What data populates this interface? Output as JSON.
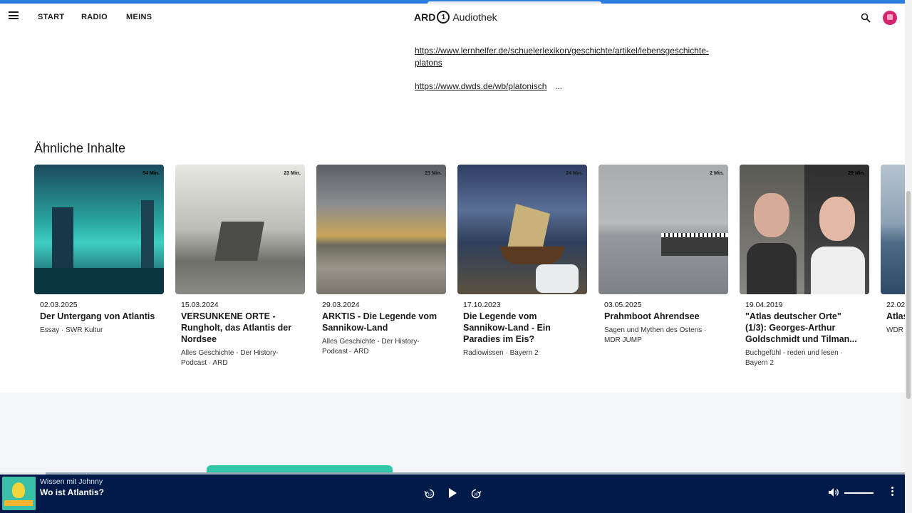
{
  "nav": {
    "items": [
      "START",
      "RADIO",
      "MEINS"
    ],
    "logo_ard": "ARD",
    "logo_one": "1",
    "logo_text": "Audiothek"
  },
  "links": {
    "link1": "https://www.lernhelfer.de/schuelerlexikon/geschichte/artikel/lebensgeschichte-platons",
    "link2": "https://www.dwds.de/wb/platonisch",
    "ellipsis": "..."
  },
  "similar": {
    "heading": "Ähnliche Inhalte",
    "cards": [
      {
        "duration": "54 Min.",
        "date": "02.03.2025",
        "title": "Der Untergang von Atlantis",
        "meta": "Essay · SWR Kultur"
      },
      {
        "duration": "23 Min.",
        "date": "15.03.2024",
        "title": "VERSUNKENE ORTE - Rungholt, das Atlantis der Nordsee",
        "meta": "Alles Geschichte - Der History-Podcast · ARD"
      },
      {
        "duration": "23 Min.",
        "date": "29.03.2024",
        "title": "ARKTIS - Die Legende vom Sannikow-Land",
        "meta": "Alles Geschichte - Der History-Podcast · ARD"
      },
      {
        "duration": "24 Min.",
        "date": "17.10.2023",
        "title": "Die Legende vom Sannikow-Land - Ein Paradies im Eis?",
        "meta": "Radiowissen · Bayern 2"
      },
      {
        "duration": "2 Min.",
        "date": "03.05.2025",
        "title": "Prahmboot Ahrendsee",
        "meta": "Sagen und Mythen des Ostens · MDR JUMP"
      },
      {
        "duration": "29 Min.",
        "date": "19.04.2019",
        "title": "\"Atlas deutscher Orte\" (1/3): Georges-Arthur Goldschmidt und Tilman...",
        "meta": "Buchgefühl - reden und lesen · Bayern 2"
      },
      {
        "duration": "",
        "date": "22.02",
        "title": "Atlas Insel Reise",
        "meta": "WDR"
      }
    ]
  },
  "player": {
    "show": "Wissen mit Johnny",
    "episode": "Wo ist Atlantis?",
    "progress": 0.05
  },
  "icons": [
    "menu-icon",
    "search-icon",
    "user-avatar",
    "rewind-15-icon",
    "play-icon",
    "forward-30-icon",
    "volume-icon",
    "more-vertical-icon"
  ]
}
